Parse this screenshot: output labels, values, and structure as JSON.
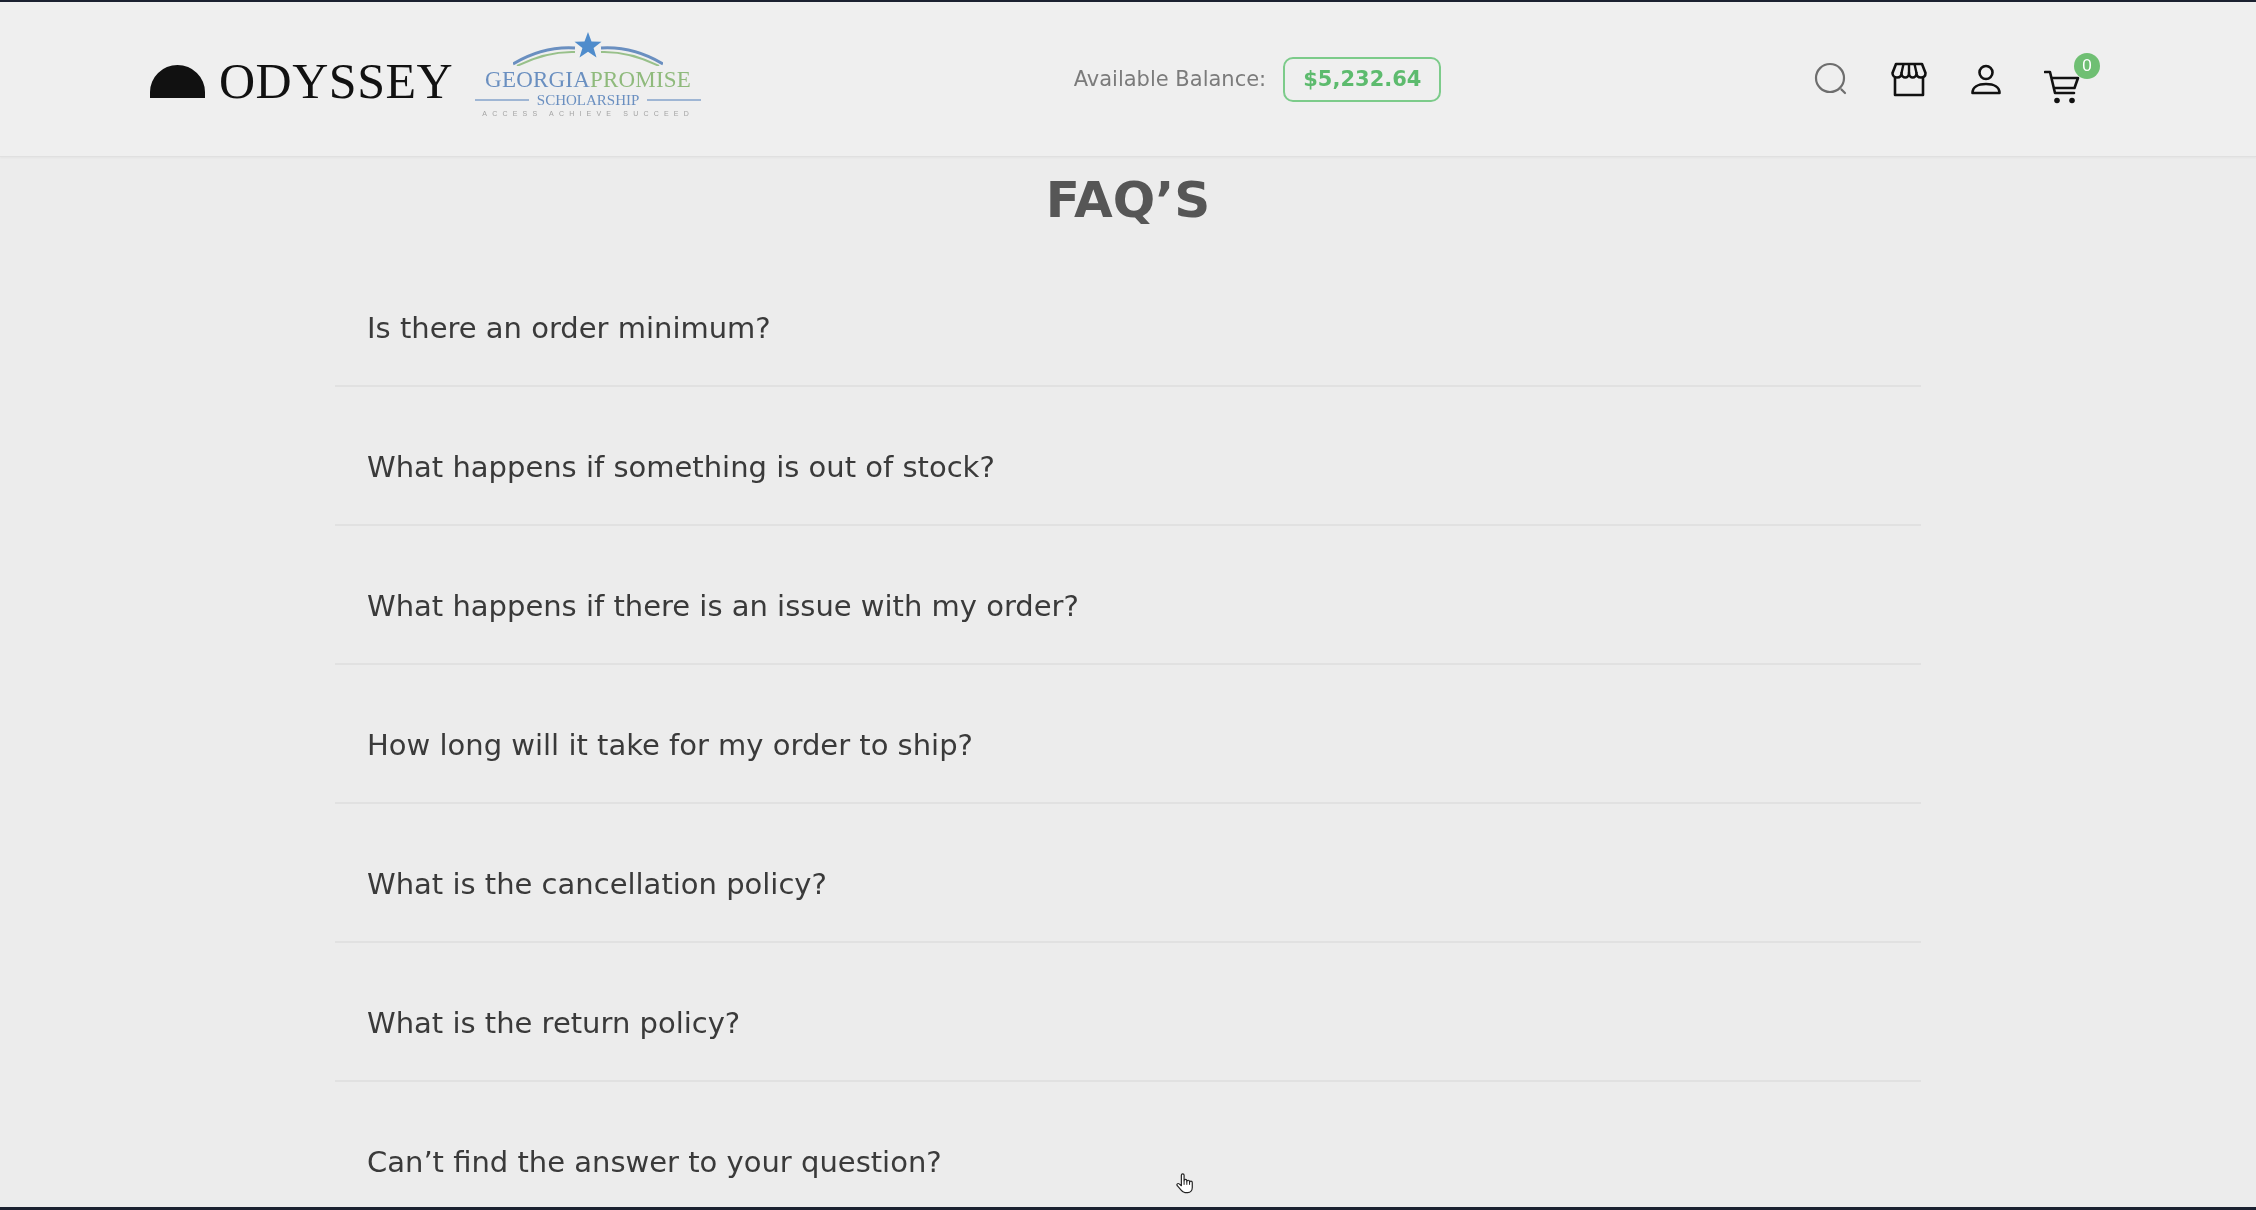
{
  "header": {
    "brand": "ODYSSEY",
    "partner_logo": {
      "word_1": "GEORGIA",
      "word_2": "PROMISE",
      "subtitle": "SCHOLARSHIP",
      "tagline": "ACCESS ACHIEVE SUCCEED"
    },
    "balance": {
      "label": "Available Balance:",
      "amount": "$5,232.64"
    },
    "cart_count": "0"
  },
  "faq": {
    "title": "FAQ’S",
    "questions": [
      "Is there an order minimum?",
      "What happens if something is out of stock?",
      "What happens if there is an issue with my order?",
      "How long will it take for my order to ship?",
      "What is the cancellation policy?",
      "What is the return policy?",
      "Can’t find the answer to your question?"
    ]
  }
}
